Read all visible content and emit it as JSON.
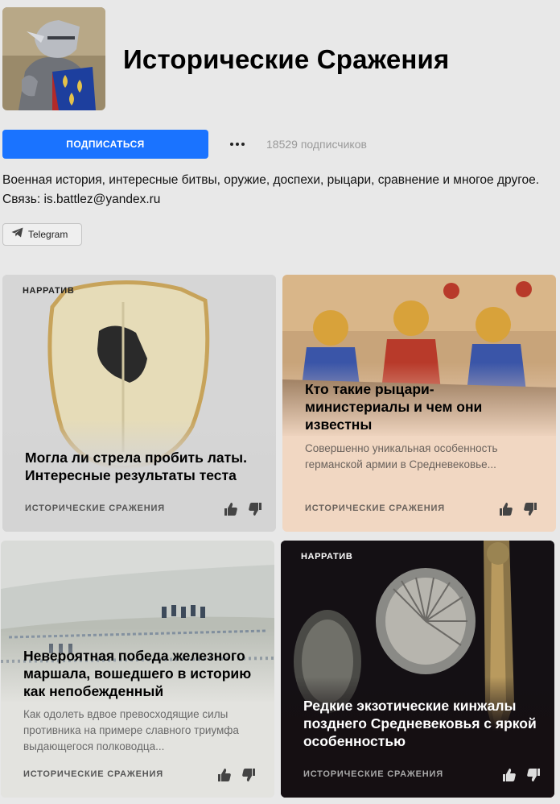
{
  "channel": {
    "title": "Исторические Сражения",
    "avatar_icon": "knight-avatar-icon",
    "subscribe_label": "ПОДПИСАТЬСЯ",
    "more_icon": "more-dots-icon",
    "subscribers": "18529 подписчиков",
    "description": "Военная история, интересные битвы, оружие, доспехи, рыцари, сравнение и многое другое. Связь: is.battlez@yandex.ru",
    "telegram_label": "Telegram",
    "telegram_icon": "telegram-plane-icon"
  },
  "colors": {
    "accent": "#1a73ff",
    "background": "#e8e8e8"
  },
  "cards": [
    {
      "badge": "НАРРАТИВ",
      "title": "Могла ли стрела пробить латы. Интересные результаты теста",
      "snippet": "",
      "source": "ИСТОРИЧЕСКИЕ СРАЖЕНИЯ",
      "image": "breastplate-armor-image"
    },
    {
      "badge": "",
      "title": "Кто такие рыцари-министериалы и чем они известны",
      "snippet": "Совершенно уникальная особенность германской армии в Средневековье...",
      "source": "ИСТОРИЧЕСКИЕ СРАЖЕНИЯ",
      "image": "medieval-knights-battle-image"
    },
    {
      "badge": "",
      "title": "Невероятная победа железного маршала, вошедшего в историю как непобежденный",
      "snippet": "Как одолеть вдвое превосходящие силы противника на примере славного триумфа выдающегося полководца...",
      "source": "ИСТОРИЧЕСКИЕ СРАЖЕНИЯ",
      "image": "battlefield-painting-image"
    },
    {
      "badge": "НАРРАТИВ",
      "title": "Редкие экзотические кинжалы позднего Средневековья с яркой особенностью",
      "snippet": "",
      "source": "ИСТОРИЧЕСКИЕ СРАЖЕНИЯ",
      "image": "ear-dagger-image"
    }
  ]
}
